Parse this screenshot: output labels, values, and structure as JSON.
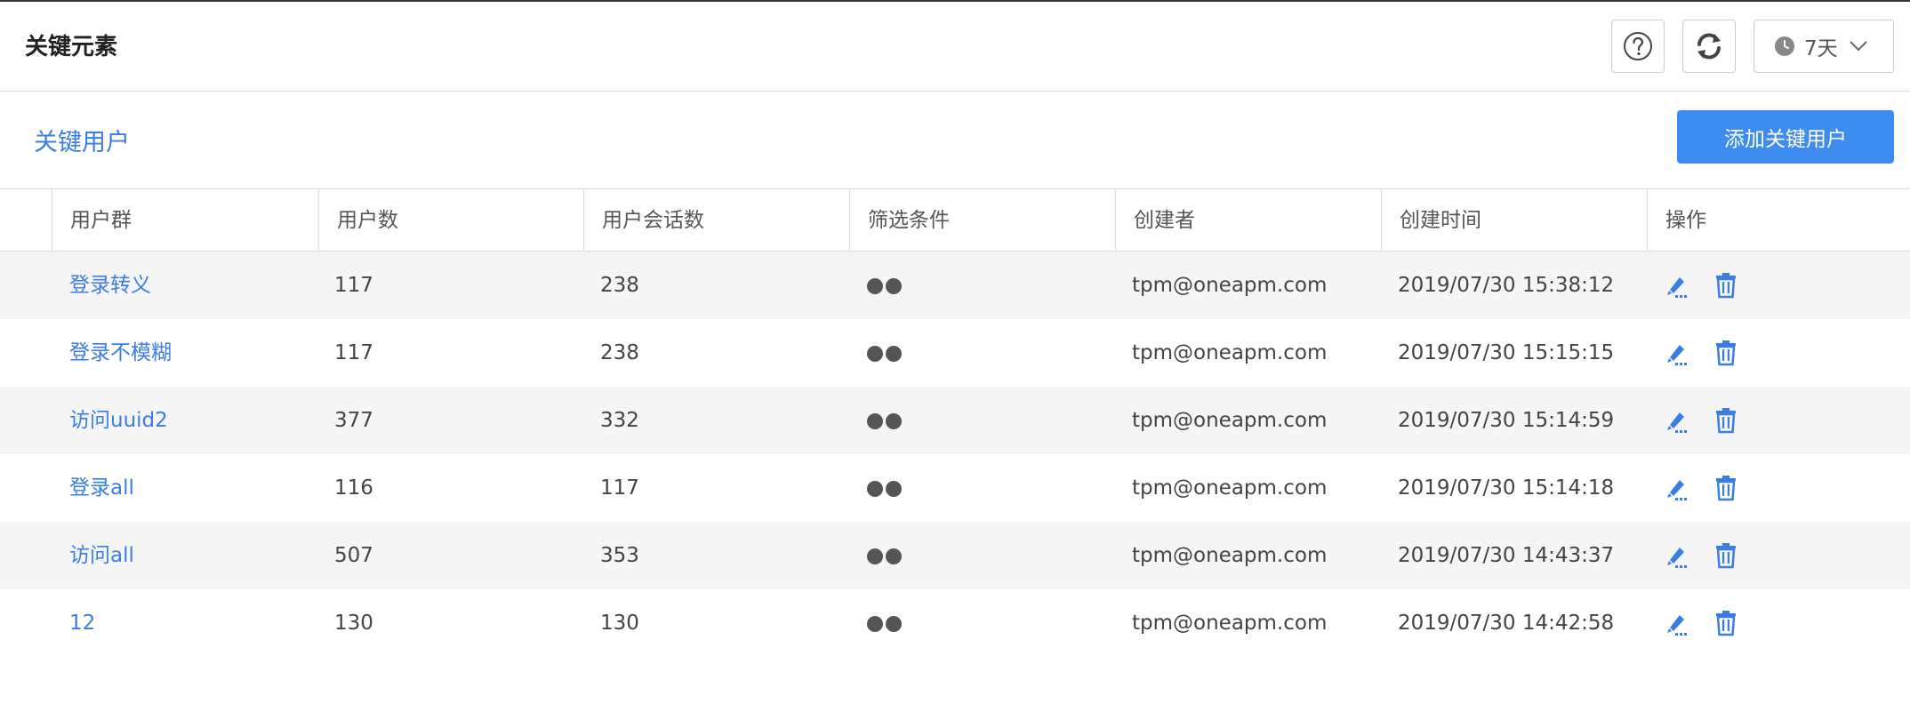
{
  "header": {
    "title": "关键元素",
    "time_range": "7天",
    "help_icon": "question-circle-icon",
    "refresh_icon": "refresh-icon"
  },
  "section": {
    "title": "关键用户",
    "add_button_label": "添加关键用户"
  },
  "colors": {
    "accent": "#3a7ee4",
    "button": "#3f8cf1",
    "stripe": "#f5f5f5",
    "dot": "#555555"
  },
  "table": {
    "columns": [
      "用户群",
      "用户数",
      "用户会话数",
      "筛选条件",
      "创建者",
      "创建时间",
      "操作"
    ],
    "rows": [
      {
        "group": "登录转义",
        "users": "117",
        "sessions": "238",
        "creator": "tpm@oneapm.com",
        "created": "2019/07/30 15:38:12"
      },
      {
        "group": "登录不模糊",
        "users": "117",
        "sessions": "238",
        "creator": "tpm@oneapm.com",
        "created": "2019/07/30 15:15:15"
      },
      {
        "group": "访问uuid2",
        "users": "377",
        "sessions": "332",
        "creator": "tpm@oneapm.com",
        "created": "2019/07/30 15:14:59"
      },
      {
        "group": "登录all",
        "users": "116",
        "sessions": "117",
        "creator": "tpm@oneapm.com",
        "created": "2019/07/30 15:14:18"
      },
      {
        "group": "访问all",
        "users": "507",
        "sessions": "353",
        "creator": "tpm@oneapm.com",
        "created": "2019/07/30 14:43:37"
      },
      {
        "group": "12",
        "users": "130",
        "sessions": "130",
        "creator": "tpm@oneapm.com",
        "created": "2019/07/30 14:42:58"
      }
    ]
  }
}
